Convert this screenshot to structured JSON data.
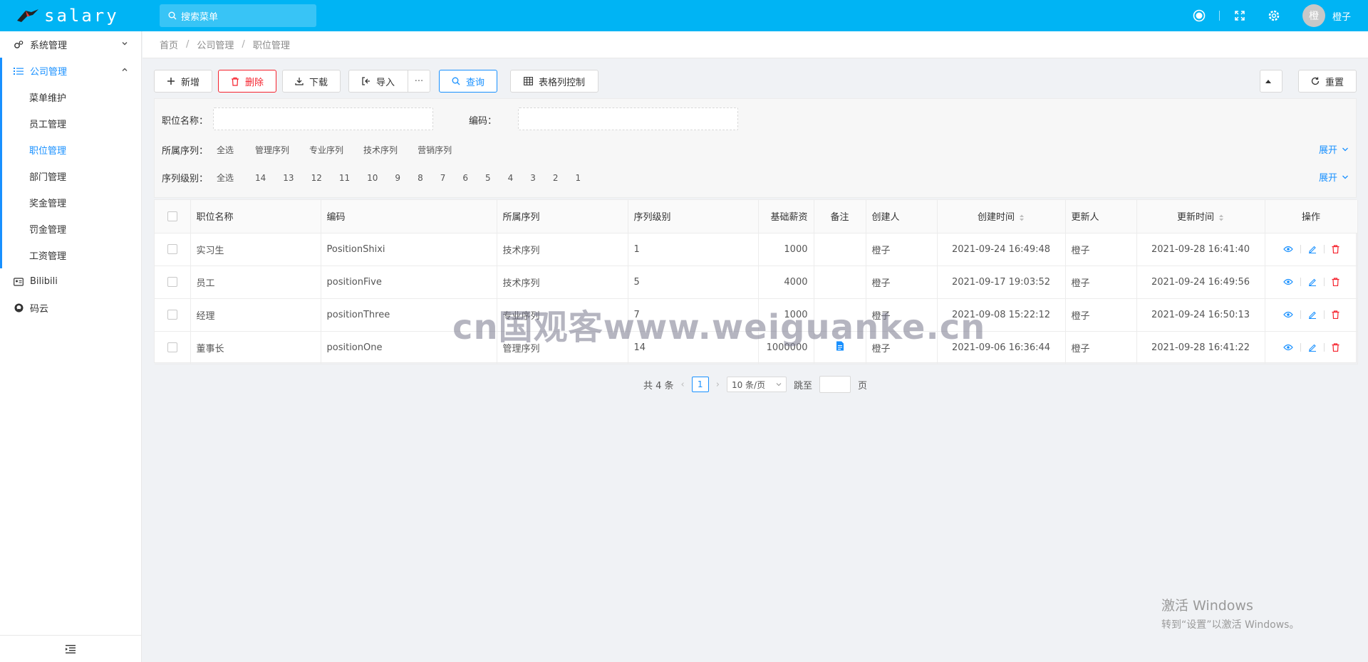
{
  "app": {
    "name": "salary"
  },
  "search": {
    "placeholder": "搜索菜单"
  },
  "user": {
    "avatar_text": "橙",
    "name": "橙子"
  },
  "sidebar": {
    "items": [
      {
        "label": "系统管理"
      },
      {
        "label": "公司管理",
        "children": [
          "菜单维护",
          "员工管理",
          "职位管理",
          "部门管理",
          "奖金管理",
          "罚金管理",
          "工资管理"
        ]
      },
      {
        "label": "Bilibili"
      },
      {
        "label": "码云"
      }
    ]
  },
  "breadcrumb": [
    "首页",
    "公司管理",
    "职位管理"
  ],
  "toolbar": {
    "add": "新增",
    "delete": "删除",
    "download": "下载",
    "import": "导入",
    "more": "···",
    "query": "查询",
    "columns": "表格列控制",
    "reset": "重置"
  },
  "filters": {
    "name_label": "职位名称：",
    "code_label": "编码：",
    "series_label": "所属序列：",
    "series_options": [
      "全选",
      "管理序列",
      "专业序列",
      "技术序列",
      "营销序列"
    ],
    "level_label": "序列级别：",
    "level_options": [
      "全选",
      "14",
      "13",
      "12",
      "11",
      "10",
      "9",
      "8",
      "7",
      "6",
      "5",
      "4",
      "3",
      "2",
      "1"
    ],
    "expand": "展开"
  },
  "table": {
    "headers": [
      "职位名称",
      "编码",
      "所属序列",
      "序列级别",
      "基础薪资",
      "备注",
      "创建人",
      "创建时间",
      "更新人",
      "更新时间",
      "操作"
    ],
    "rows": [
      {
        "name": "实习生",
        "code": "PositionShixi",
        "series": "技术序列",
        "level": "1",
        "salary": "1000",
        "creator": "橙子",
        "created": "2021-09-24 16:49:48",
        "updater": "橙子",
        "updated": "2021-09-28 16:41:40"
      },
      {
        "name": "员工",
        "code": "positionFive",
        "series": "技术序列",
        "level": "5",
        "salary": "4000",
        "creator": "橙子",
        "created": "2021-09-17 19:03:52",
        "updater": "橙子",
        "updated": "2021-09-24 16:49:56"
      },
      {
        "name": "经理",
        "code": "positionThree",
        "series": "专业序列",
        "level": "7",
        "salary": "1000",
        "creator": "橙子",
        "created": "2021-09-08 15:22:12",
        "updater": "橙子",
        "updated": "2021-09-24 16:50:13"
      },
      {
        "name": "董事长",
        "code": "positionOne",
        "series": "管理序列",
        "level": "14",
        "salary": "1000000",
        "creator": "橙子",
        "created": "2021-09-06 16:36:44",
        "updater": "橙子",
        "updated": "2021-09-28 16:41:22"
      }
    ]
  },
  "pagination": {
    "total": "共 4 条",
    "current": "1",
    "page_size": "10 条/页",
    "jump_label": "跳至",
    "page_suffix": "页"
  },
  "watermark": "cn国观客www.weiguanke.cn",
  "windows": {
    "line1": "激活 Windows",
    "line2": "转到“设置”以激活 Windows。"
  },
  "colors": {
    "topbar": "#00b4f4",
    "accent": "#1890ff",
    "danger": "#f5222d"
  }
}
